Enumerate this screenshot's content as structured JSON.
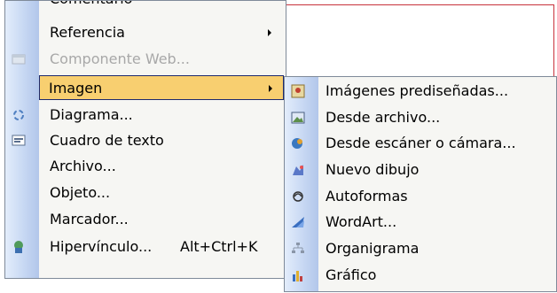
{
  "menu": {
    "partial_top_label": "Comentario",
    "items": [
      {
        "label": "Referencia",
        "has_submenu": true,
        "disabled": false
      },
      {
        "label": "Componente Web...",
        "disabled": true
      },
      {
        "label": "Imagen",
        "has_submenu": true,
        "highlighted": true
      },
      {
        "label": "Diagrama...",
        "icon": "diagram-icon"
      },
      {
        "label": "Cuadro de texto",
        "icon": "textbox-icon"
      },
      {
        "label": "Archivo..."
      },
      {
        "label": "Objeto..."
      },
      {
        "label": "Marcador..."
      },
      {
        "label": "Hipervínculo...",
        "shortcut": "Alt+Ctrl+K",
        "icon": "hyperlink-icon"
      }
    ]
  },
  "submenu": {
    "items": [
      {
        "label": "Imágenes prediseñadas...",
        "icon": "clipart-icon"
      },
      {
        "label": "Desde archivo...",
        "icon": "picture-file-icon"
      },
      {
        "label": "Desde escáner o cámara...",
        "icon": "scanner-icon"
      },
      {
        "label": "Nuevo dibujo",
        "icon": "drawing-icon"
      },
      {
        "label": "Autoformas",
        "icon": "autoshapes-icon"
      },
      {
        "label": "WordArt...",
        "icon": "wordart-icon"
      },
      {
        "label": "Organigrama",
        "icon": "org-chart-icon"
      },
      {
        "label": "Gráfico",
        "icon": "chart-icon"
      }
    ]
  },
  "colors": {
    "highlight": "#f8cf70",
    "highlight_border": "#1e2a6d",
    "menu_bg": "#f6f6f3",
    "icon_bar": "#c7d8f3",
    "disabled_text": "#a8a8a8"
  }
}
